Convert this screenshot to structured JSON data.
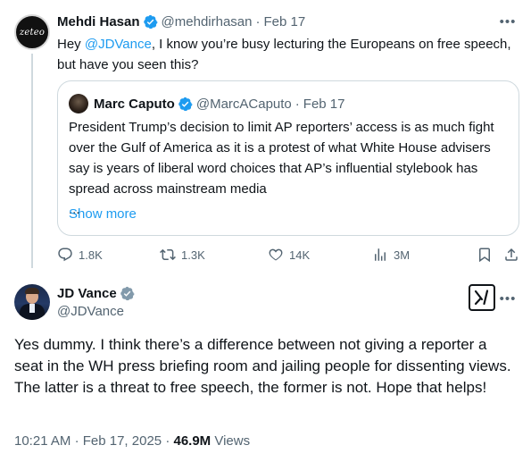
{
  "parent_tweet": {
    "author_avatar_text": "zeteo",
    "author_name": "Mehdi Hasan",
    "author_handle": "@mehdirhasan",
    "separator": "·",
    "date": "Feb 17",
    "text_prefix": "Hey ",
    "mention": "@JDVance",
    "text_suffix": ", I know you’re busy lecturing the Europeans on free speech, but have you seen this?",
    "quoted_tweet": {
      "author_name": "Marc Caputo",
      "author_handle": "@MarcACaputo",
      "separator": "·",
      "date": "Feb 17",
      "text": "President Trump’s decision to limit AP reporters’ access is as much fight over the Gulf of America as it is a protest of what White House advisers say is years of liberal word choices that AP’s influential stylebook has spread across mainstream media",
      "ellipsis": "...",
      "show_more": "Show more"
    },
    "actions": {
      "replies": "1.8K",
      "reposts": "1.3K",
      "likes": "14K",
      "views": "3M"
    }
  },
  "reply_tweet": {
    "author_name": "JD Vance",
    "author_handle": "@JDVance",
    "text": "Yes dummy. I think there’s a difference between not giving a reporter a seat in the WH press briefing room and jailing people for dissenting views. The latter is a threat to free speech, the former is not. Hope that helps!",
    "time": "10:21 AM",
    "separator": "·",
    "date": "Feb 17, 2025",
    "separator2": "·",
    "views_count": "46.9M",
    "views_label": "Views"
  },
  "colors": {
    "accent": "#1d9bf0",
    "muted": "#536471",
    "text": "#0f1419",
    "border": "#cfd9de"
  },
  "icons": [
    "verified-badge-icon",
    "more-icon",
    "reply-icon",
    "repost-icon",
    "like-icon",
    "views-icon",
    "bookmark-icon",
    "share-icon",
    "grok-icon"
  ]
}
